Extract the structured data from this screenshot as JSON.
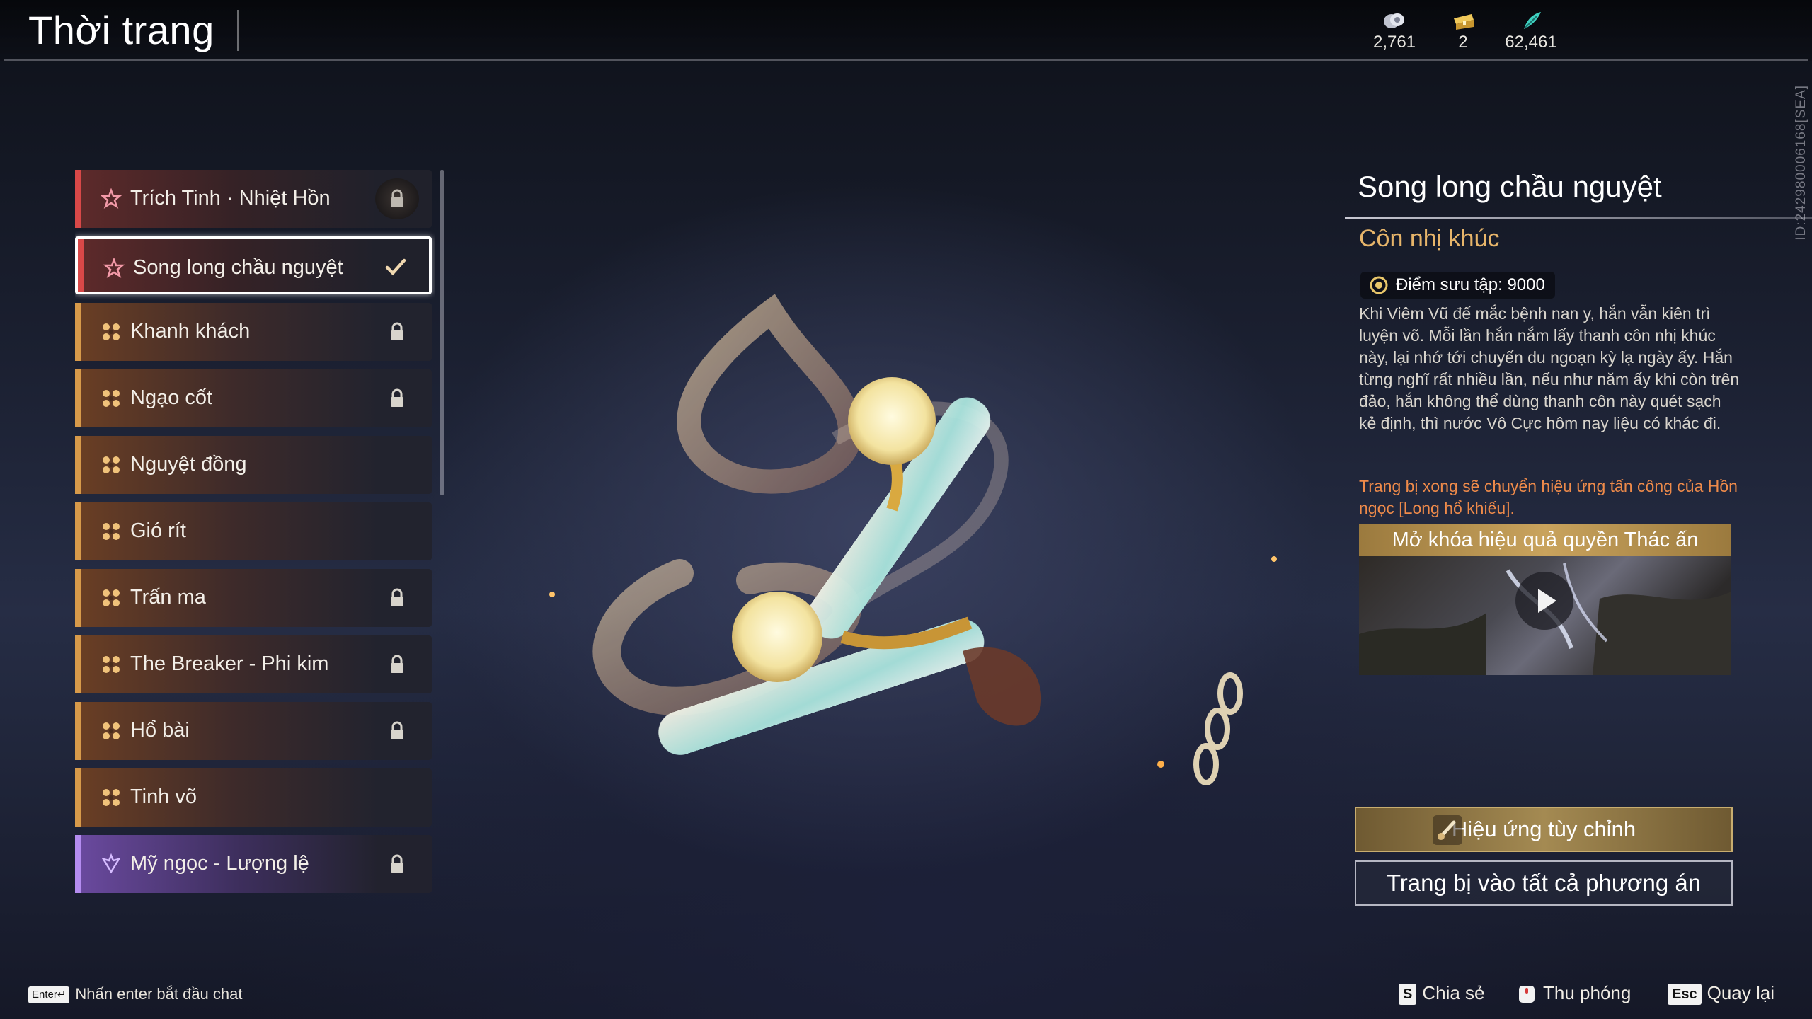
{
  "header": {
    "title": "Thời trang",
    "currencies": [
      {
        "icon": "coin-stack-icon",
        "value": "2,761"
      },
      {
        "icon": "treasure-chest-icon",
        "value": "2"
      },
      {
        "icon": "feather-icon",
        "value": "62,461"
      }
    ]
  },
  "side_id": "ID:242980006168[SEA]",
  "list": {
    "items": [
      {
        "label": "Trích Tinh · Nhiệt Hồn",
        "tier": "red",
        "locked": true,
        "selected": false
      },
      {
        "label": "Song long chầu nguyệt",
        "tier": "red",
        "locked": false,
        "selected": true
      },
      {
        "label": "Khanh khách",
        "tier": "gold",
        "locked": true,
        "selected": false
      },
      {
        "label": "Ngạo cốt",
        "tier": "gold",
        "locked": true,
        "selected": false
      },
      {
        "label": "Nguyệt đồng",
        "tier": "gold",
        "locked": false,
        "selected": false
      },
      {
        "label": "Gió rít",
        "tier": "gold",
        "locked": false,
        "selected": false
      },
      {
        "label": "Trấn ma",
        "tier": "gold",
        "locked": true,
        "selected": false
      },
      {
        "label": "The Breaker - Phi kim",
        "tier": "gold",
        "locked": true,
        "selected": false
      },
      {
        "label": "Hổ bài",
        "tier": "gold",
        "locked": true,
        "selected": false
      },
      {
        "label": "Tinh võ",
        "tier": "gold",
        "locked": false,
        "selected": false
      },
      {
        "label": "Mỹ ngọc - Lượng lệ",
        "tier": "purple",
        "locked": true,
        "selected": false
      }
    ]
  },
  "detail": {
    "name": "Song long chầu nguyệt",
    "subtitle": "Côn nhị khúc",
    "collection_points": "Điểm sưu tập: 9000",
    "description": "Khi Viêm Vũ đế mắc bệnh nan y, hắn vẫn kiên trì luyện võ. Mỗi lần hắn nắm lấy thanh côn nhị khúc này, lại nhớ tới chuyến du ngoạn kỳ lạ ngày ấy. Hắn từng nghĩ rất nhiều lần, nếu như năm ấy khi còn trên đảo, hắn không thể dùng thanh côn này quét sạch kẻ định, thì nước Vô Cực hôm nay liệu có khác đi.",
    "effect_note": "Trang bị xong sẽ chuyển hiệu ứng tấn công của Hồn ngọc [Long hổ khiếu].",
    "unlock_banner": "Mở khóa hiệu quả quyền Thác ấn",
    "custom_effect_button": "Hiệu ứng tùy chỉnh",
    "equip_all_button": "Trang bị vào tất cả phương án"
  },
  "footer": {
    "enter_key": "Enter↵",
    "enter_hint": "Nhấn enter bắt đầu chat",
    "share_key": "S",
    "share_label": "Chia sẻ",
    "zoom_label": "Thu phóng",
    "back_key": "Esc",
    "back_label": "Quay lại"
  }
}
